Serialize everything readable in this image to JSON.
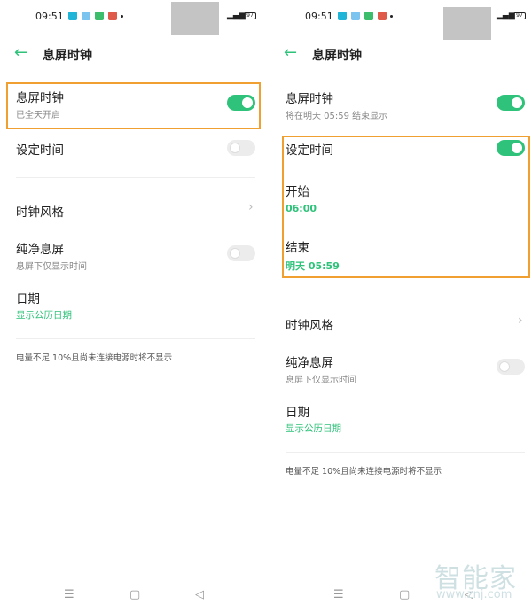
{
  "status_bar": {
    "time": "09:51",
    "network": "4G",
    "battery": "97"
  },
  "header": {
    "title": "息屏时钟",
    "back_icon": "arrow-left-icon"
  },
  "left": {
    "aod": {
      "label": "息屏时钟",
      "sub": "已全天开启",
      "on": true
    },
    "schedule": {
      "label": "设定时间",
      "on": false
    },
    "clock_style": {
      "label": "时钟风格"
    },
    "pure": {
      "label": "纯净息屏",
      "sub": "息屏下仅显示时间",
      "on": false
    },
    "date": {
      "label": "日期",
      "sub": "显示公历日期"
    },
    "note": "电量不足 10%且尚未连接电源时将不显示"
  },
  "right": {
    "aod": {
      "label": "息屏时钟",
      "sub": "将在明天 05:59 结束显示",
      "on": true
    },
    "schedule": {
      "label": "设定时间",
      "on": true
    },
    "start": {
      "label": "开始",
      "value": "06:00"
    },
    "end": {
      "label": "结束",
      "value": "明天 05:59"
    },
    "clock_style": {
      "label": "时钟风格"
    },
    "pure": {
      "label": "纯净息屏",
      "sub": "息屏下仅显示时间",
      "on": false
    },
    "date": {
      "label": "日期",
      "sub": "显示公历日期"
    },
    "note": "电量不足 10%且尚未连接电源时将不显示"
  },
  "watermark": {
    "brand": "智能家",
    "url": "www.znj.com"
  },
  "colors": {
    "accent": "#2fc27a",
    "highlight": "#f0a030"
  }
}
